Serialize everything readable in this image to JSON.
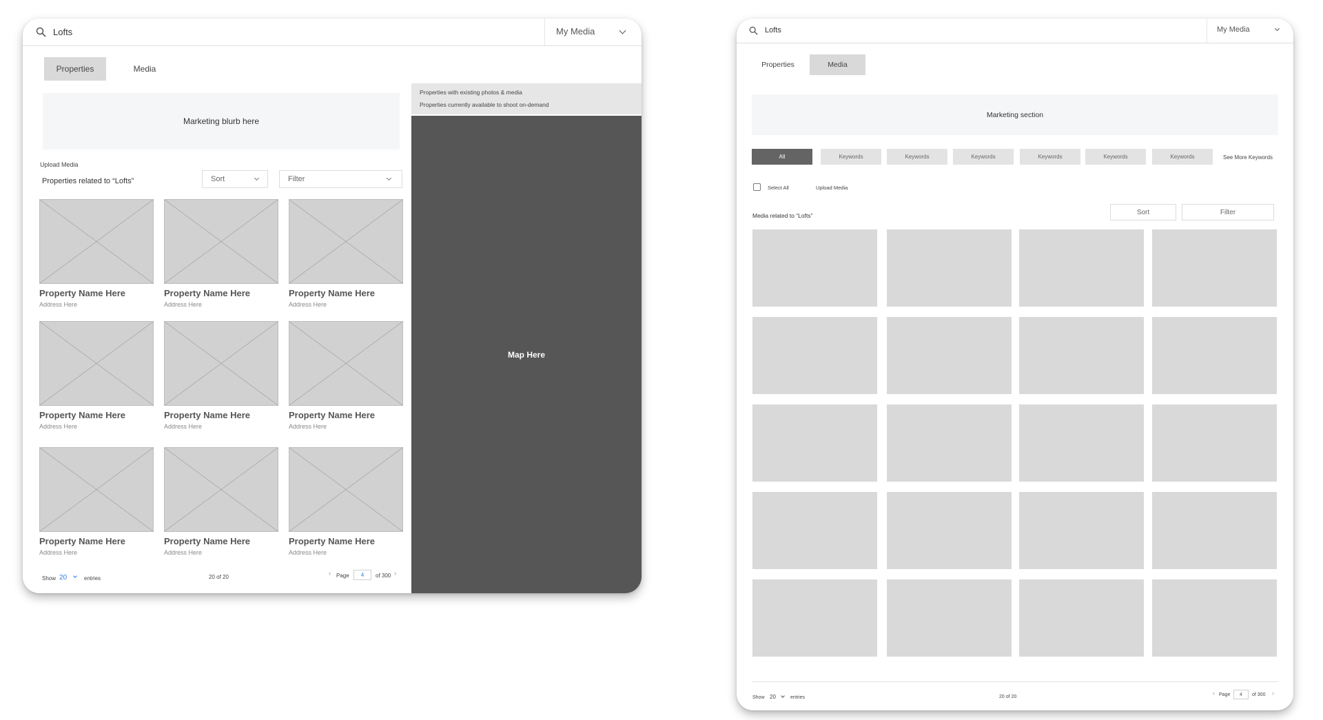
{
  "left": {
    "search_query": "Lofts",
    "account_menu": "My Media",
    "tabs": [
      {
        "label": "Properties",
        "active": true
      },
      {
        "label": "Media",
        "active": false
      }
    ],
    "marketing_text": "Marketing blurb here",
    "upload_link": "Upload Media",
    "results_heading": "Properties related to “Lofts”",
    "sort_label": "Sort",
    "filter_label": "Filter",
    "properties": [
      {
        "name": "Property Name Here",
        "address": "Address Here"
      },
      {
        "name": "Property Name Here",
        "address": "Address Here"
      },
      {
        "name": "Property Name Here",
        "address": "Address Here"
      },
      {
        "name": "Property Name Here",
        "address": "Address Here"
      },
      {
        "name": "Property Name Here",
        "address": "Address Here"
      },
      {
        "name": "Property Name Here",
        "address": "Address Here"
      },
      {
        "name": "Property Name Here",
        "address": "Address Here"
      },
      {
        "name": "Property Name Here",
        "address": "Address Here"
      },
      {
        "name": "Property Name Here",
        "address": "Address Here"
      }
    ],
    "legend": [
      "Properties with existing photos & media",
      "Properties currently available to shoot on-demand"
    ],
    "map_label": "Map Here",
    "pagination": {
      "show_label": "Show",
      "page_size": "20",
      "entries_label": "entries",
      "count": "20 of 20",
      "page_label": "Page",
      "page": "4",
      "of_label": "of 300"
    }
  },
  "right": {
    "search_query": "Lofts",
    "account_menu": "My Media",
    "tabs": [
      {
        "label": "Properties",
        "active": false
      },
      {
        "label": "Media",
        "active": true
      }
    ],
    "marketing_text": "Marketing section",
    "chips": [
      {
        "label": "All",
        "active": true
      },
      {
        "label": "Keywords",
        "active": false
      },
      {
        "label": "Keywords",
        "active": false
      },
      {
        "label": "Keywords",
        "active": false
      },
      {
        "label": "Keywords",
        "active": false
      },
      {
        "label": "Keywords",
        "active": false
      },
      {
        "label": "Keywords",
        "active": false
      }
    ],
    "see_more": "See More Keywords",
    "select_all": "Select All",
    "upload_link": "Upload Media",
    "results_heading": "Media related to “Lofts”",
    "sort_label": "Sort",
    "filter_label": "Filter",
    "media_tile_count": 20,
    "pagination": {
      "show_label": "Show",
      "page_size": "20",
      "entries_label": "entries",
      "count": "20 of 20",
      "page_label": "Page",
      "page": "4",
      "of_label": "of 300"
    }
  },
  "colors": {
    "accent": "#2c7be5",
    "map_bg": "#565656",
    "active_chip": "#646464",
    "placeholder": "#d9d9d9"
  },
  "icons": [
    "search-icon",
    "chevron-down-icon",
    "chevron-left-icon",
    "chevron-right-icon"
  ]
}
